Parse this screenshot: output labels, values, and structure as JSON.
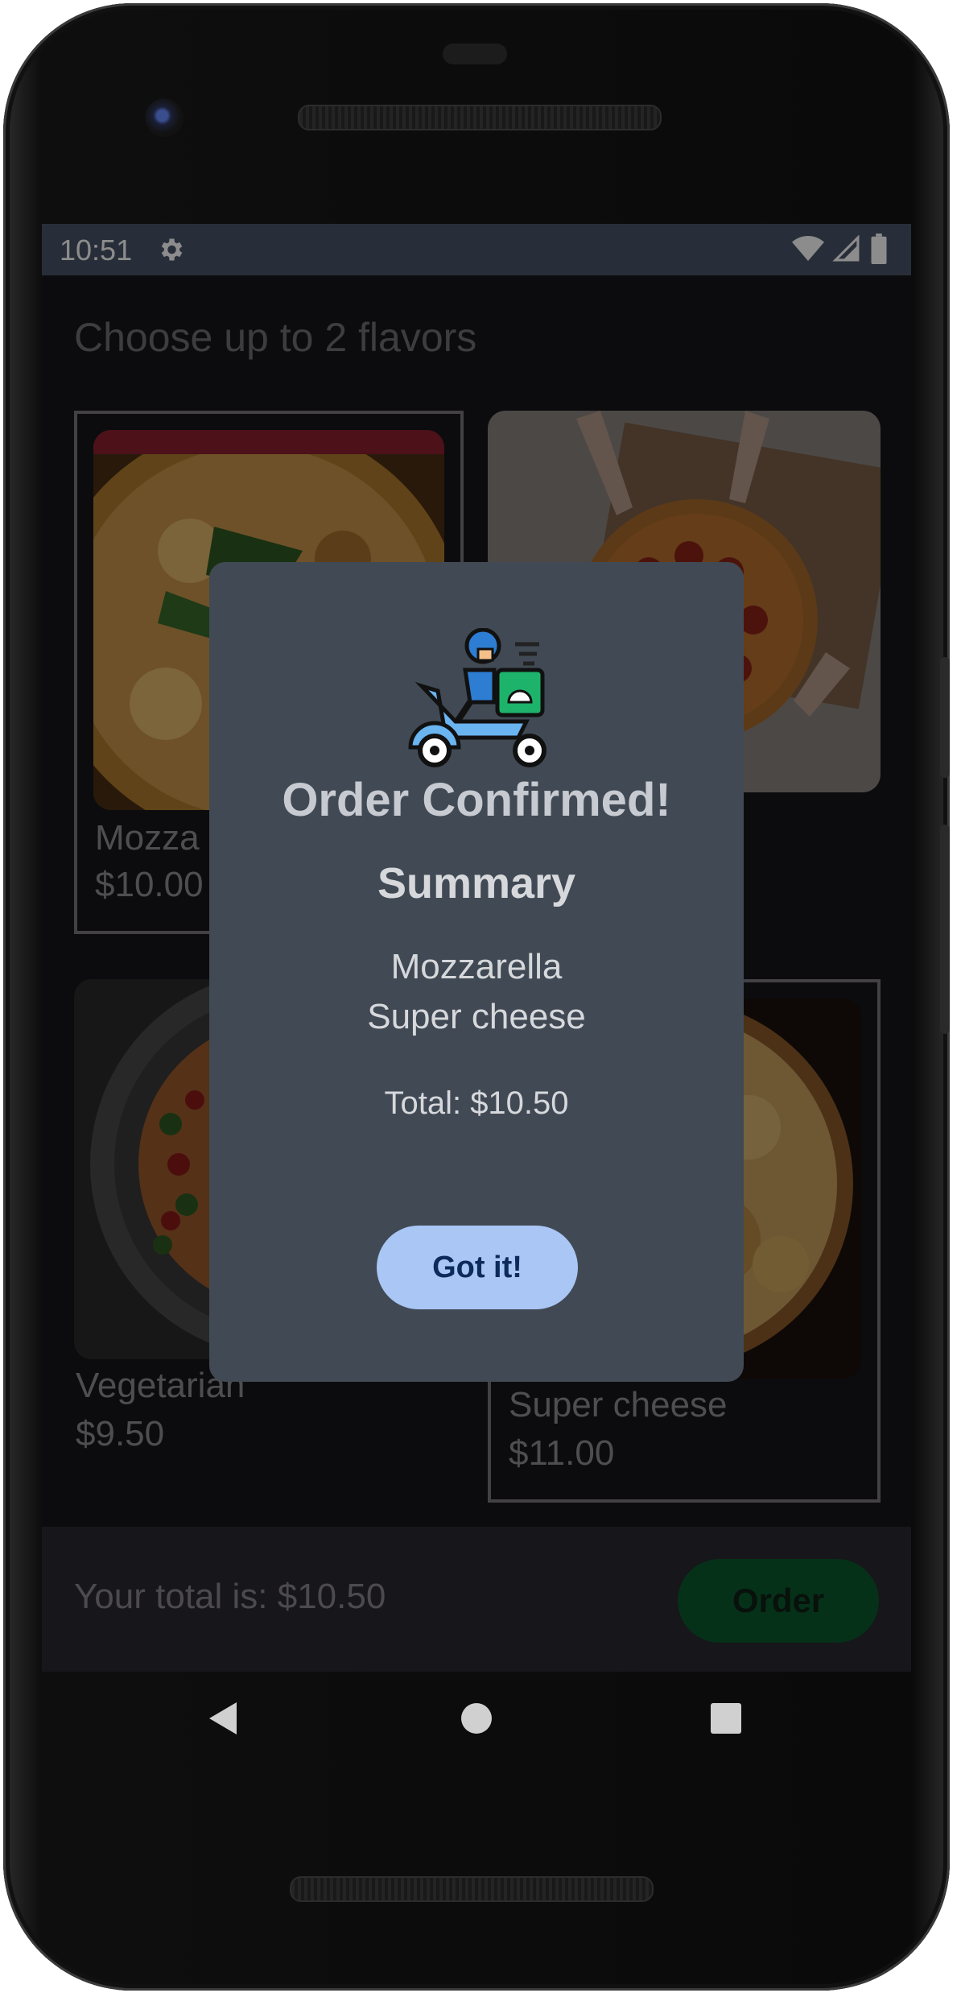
{
  "status_bar": {
    "time": "10:51",
    "settings_icon": "gear-icon",
    "wifi_icon": "wifi-icon",
    "signal_icon": "signal-icon",
    "battery_icon": "battery-icon"
  },
  "screen": {
    "title": "Choose up to 2 flavors",
    "items": [
      {
        "name": "Mozzarella",
        "price": "$10.00",
        "selected": true
      },
      {
        "name": "",
        "price": "",
        "selected": false
      },
      {
        "name": "Vegetarian",
        "price": "$9.50",
        "selected": false
      },
      {
        "name": "Super cheese",
        "price": "$11.00",
        "selected": true
      }
    ],
    "visible_partial_labels": {
      "mozzarella_name": "Mozza",
      "mozzarella_price": "$10.00",
      "vegetarian_name": "Vegetarian"
    }
  },
  "bottom_bar": {
    "total_text": "Your total is: $10.50",
    "order_label": "Order"
  },
  "dialog": {
    "icon": "delivery-scooter-icon",
    "title": "Order Confirmed!",
    "summary_heading": "Summary",
    "summary_items": [
      "Mozzarella",
      "Super cheese"
    ],
    "total": "Total: $10.50",
    "button_label": "Got it!"
  },
  "nav_bar": {
    "back_icon": "back-triangle-icon",
    "home_icon": "home-circle-icon",
    "recents_icon": "recents-square-icon"
  },
  "colors": {
    "status_bar": "#4a5568",
    "dialog_bg": "#414a54",
    "got_it_button": "#a9c6f5",
    "order_button": "#0b5a2e"
  }
}
